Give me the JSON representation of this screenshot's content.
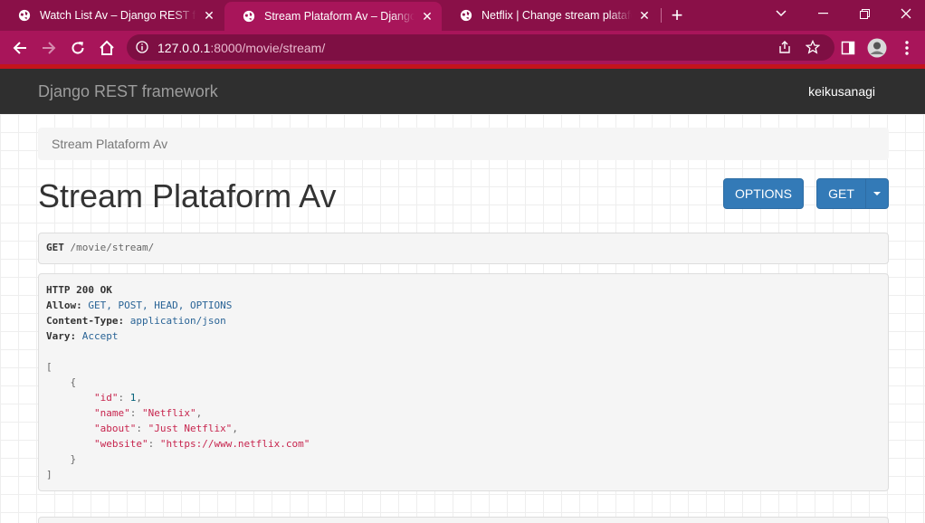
{
  "browser": {
    "tabs": [
      {
        "title": "Watch List Av – Django REST framework",
        "active": false
      },
      {
        "title": "Stream Plataform Av – Django REST framework",
        "active": true
      },
      {
        "title": "Netflix | Change stream plataform | Django site admin",
        "active": false
      }
    ],
    "close_glyph": "✕",
    "new_tab_glyph": "+",
    "url_host": "127.0.0.1",
    "url_rest": ":8000/movie/stream/"
  },
  "navbar": {
    "brand": "Django REST framework",
    "user": "keikusanagi"
  },
  "breadcrumb": "Stream Plataform Av",
  "page_title": "Stream Plataform Av",
  "buttons": {
    "options": "OPTIONS",
    "get": "GET"
  },
  "request": {
    "method": "GET",
    "path": "/movie/stream/"
  },
  "response": {
    "status": "HTTP 200 OK",
    "headers": [
      {
        "name": "Allow",
        "value": "GET, POST, HEAD, OPTIONS"
      },
      {
        "name": "Content-Type",
        "value": "application/json"
      },
      {
        "name": "Vary",
        "value": "Accept"
      }
    ],
    "body": {
      "id": "1",
      "name": "\"Netflix\"",
      "about": "\"Just Netflix\"",
      "website": "\"https://www.netflix.com\""
    }
  },
  "colors": {
    "tab_bar": "#8a1048",
    "toolbar": "#a8155a",
    "accent_line": "#c4141c",
    "navbar": "#2f2f2f",
    "button": "#337ab7"
  }
}
